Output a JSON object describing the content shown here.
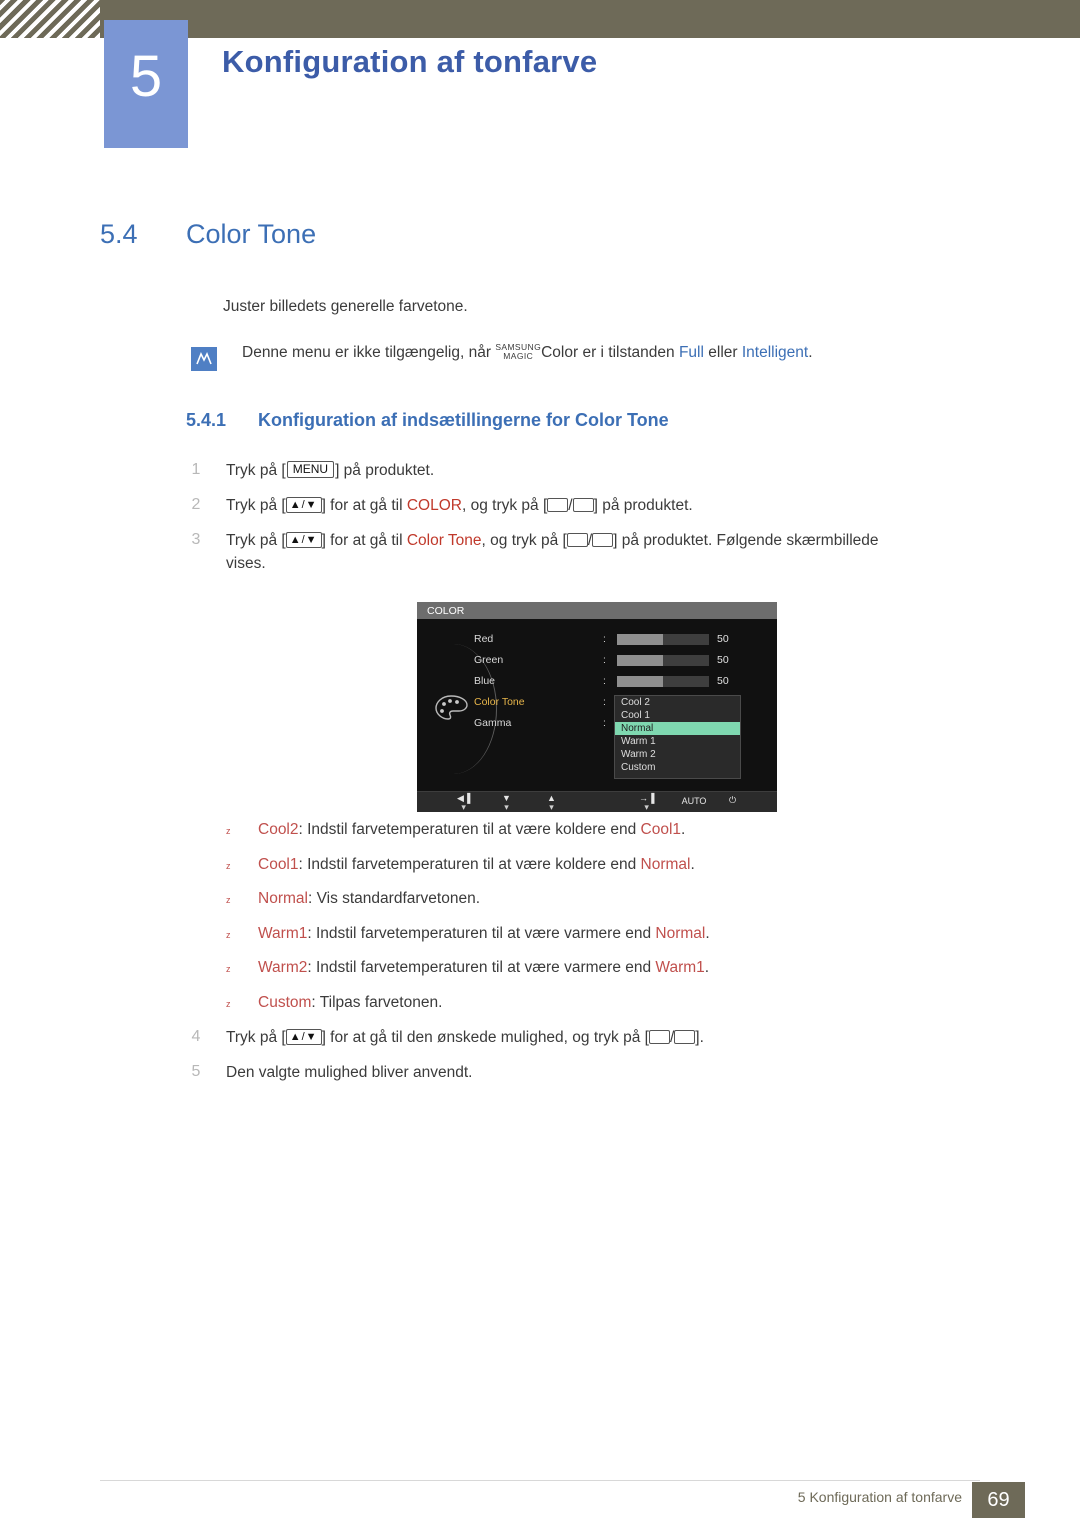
{
  "header": {
    "chapter_number": "5",
    "chapter_title": "Konfiguration af tonfarve"
  },
  "section": {
    "number": "5.4",
    "title": "Color Tone",
    "intro": "Juster billedets generelle farvetone."
  },
  "note": {
    "icon": "note-icon",
    "text_before": "Denne menu er ikke tilgængelig, når",
    "magic_line1": "SAMSUNG",
    "magic_line2": "MAGIC",
    "magic_word": "Color",
    "text_middle": "er i tilstanden",
    "option_full": "Full",
    "text_or": "eller",
    "option_intelligent": "Intelligent",
    "text_end": "."
  },
  "subsection": {
    "number": "5.4.1",
    "title": "Konfiguration af indsætillingerne for Color Tone"
  },
  "steps": [
    {
      "num": "1",
      "parts": [
        "Tryk på [",
        "MENU",
        "] på produktet."
      ]
    },
    {
      "num": "2",
      "before": "Tryk på [",
      "arrows": "▲/▼",
      "mid1": "] for at gå til",
      "kw": "COLOR",
      "mid2": ", og tryk på [",
      "mid3": "/",
      "after": "] på produktet."
    },
    {
      "num": "3",
      "before": "Tryk på [",
      "arrows": "▲/▼",
      "mid1": "] for at gå til",
      "kw": "Color Tone",
      "mid2": ", og tryk på [",
      "mid3": "/",
      "after": "] på produktet. Følgende skærmbillede",
      "line2": "vises."
    },
    {
      "num": "4",
      "before": "Tryk på [",
      "arrows": "▲/▼",
      "mid1": "] for at gå til den ønskede mulighed, og tryk på [",
      "mid3": "/",
      "after": "]."
    },
    {
      "num": "5",
      "text": "Den valgte mulighed bliver anvendt."
    }
  ],
  "osd": {
    "title": "COLOR",
    "rows": [
      {
        "label": "Red",
        "colon": ":",
        "value": "50"
      },
      {
        "label": "Green",
        "colon": ":",
        "value": "50"
      },
      {
        "label": "Blue",
        "colon": ":",
        "value": "50"
      },
      {
        "label": "Color Tone",
        "colon": ":",
        "value": ""
      },
      {
        "label": "Gamma",
        "colon": ":",
        "value": ""
      }
    ],
    "menu_options": [
      "Cool 2",
      "Cool 1",
      "Normal",
      "Warm 1",
      "Warm 2",
      "Custom"
    ],
    "selected_option": "Normal",
    "footer_buttons": [
      "◀▐",
      "▼",
      "▲",
      "→▐",
      "AUTO",
      "⏻"
    ],
    "footer_auto_label": "AUTO",
    "highlight_color": "#7fd8b0",
    "colortone_label_color": "#e7b54a"
  },
  "bullets": [
    {
      "kw": "Cool2",
      "rest": ": Indstil farvetemperaturen til at være koldere end",
      "kw2": "Cool1",
      "end": "."
    },
    {
      "kw": "Cool1",
      "rest": ": Indstil farvetemperaturen til at være koldere end",
      "kw2": "Normal",
      "end": "."
    },
    {
      "kw": "Normal",
      "rest": ": Vis standardfarvetonen.",
      "kw2": "",
      "end": ""
    },
    {
      "kw": "Warm1",
      "rest": ": Indstil farvetemperaturen til at være varmere end",
      "kw2": "Normal",
      "end": "."
    },
    {
      "kw": "Warm2",
      "rest": ": Indstil farvetemperaturen til at være varmere end",
      "kw2": "Warm1",
      "end": "."
    },
    {
      "kw": "Custom",
      "rest": ": Tilpas farvetonen.",
      "kw2": "",
      "end": ""
    }
  ],
  "footer": {
    "text": "5 Konfiguration af tonfarve",
    "page": "69"
  }
}
